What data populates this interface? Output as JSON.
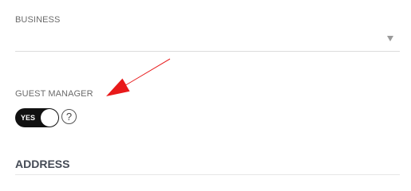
{
  "business": {
    "label": "BUSINESS",
    "value": ""
  },
  "guest_manager": {
    "label": "GUEST MANAGER",
    "toggle_text": "YES",
    "enabled": true,
    "help_glyph": "?"
  },
  "address": {
    "title": "ADDRESS"
  },
  "annotation": {
    "color": "#e8191a"
  },
  "icons": {
    "select_caret": "chevron-down-icon",
    "help": "question-circle-icon",
    "annotation": "arrow-icon"
  }
}
